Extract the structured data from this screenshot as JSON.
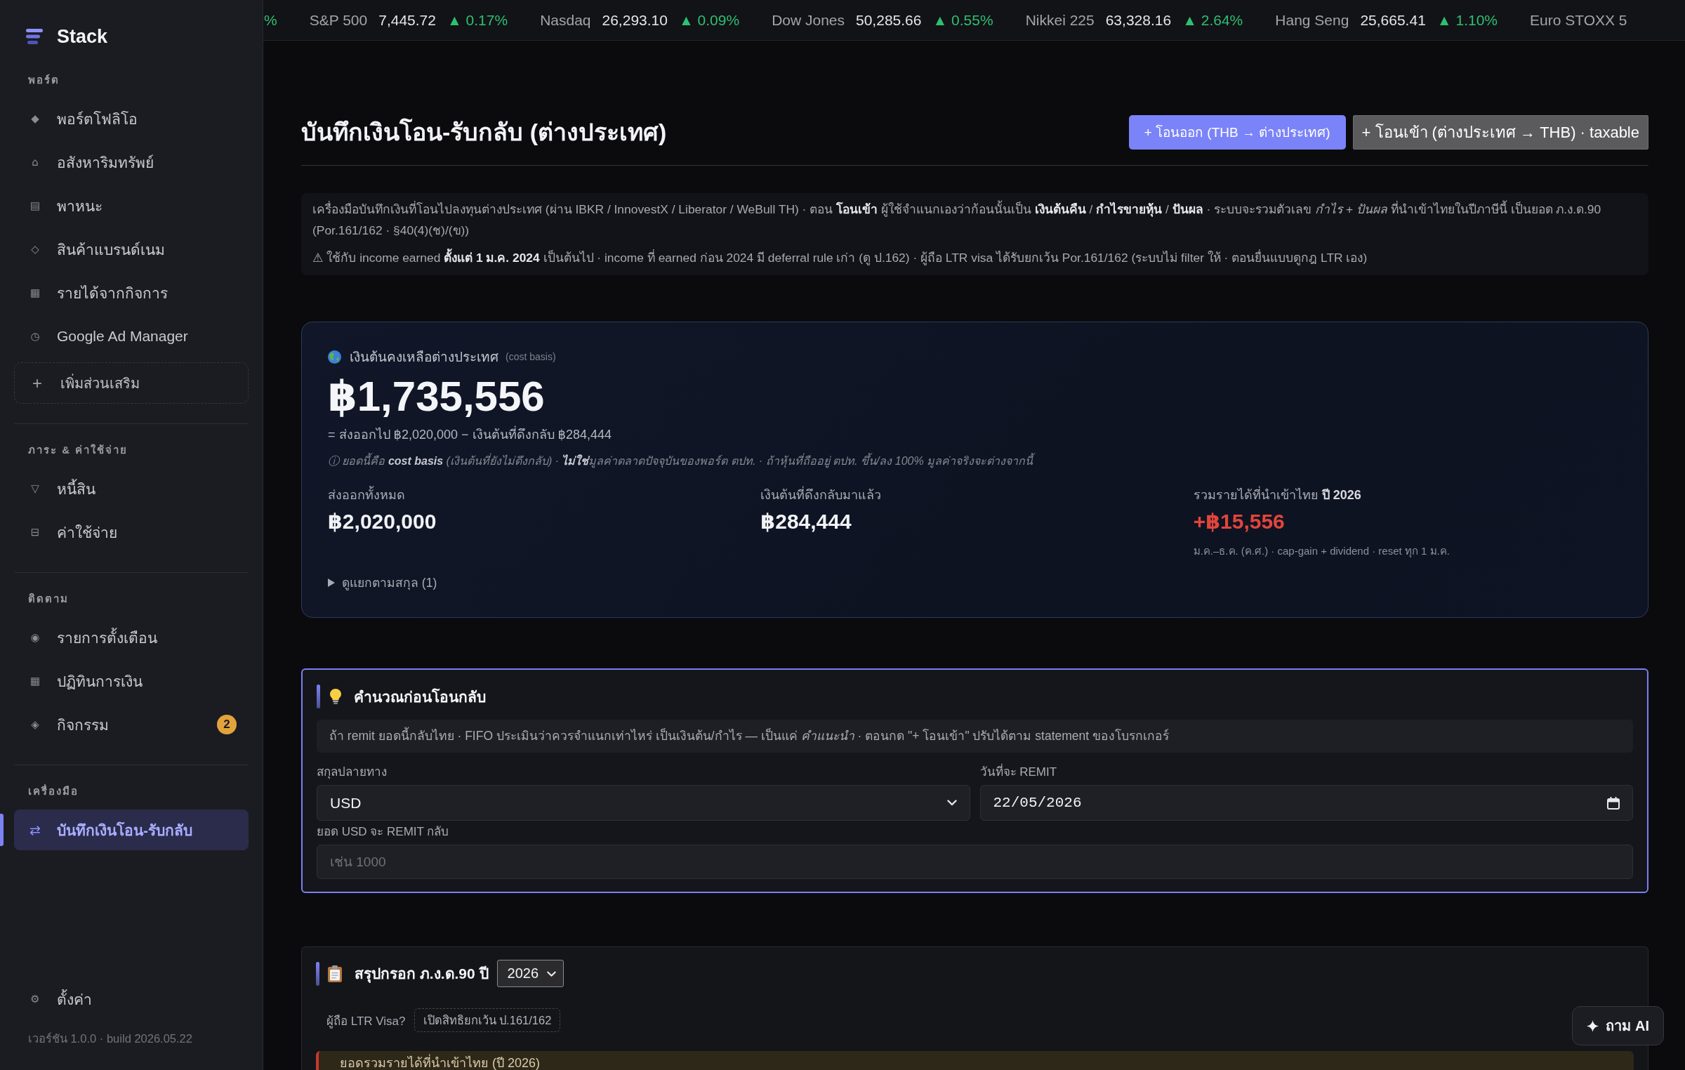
{
  "sidebar": {
    "brand": "Stack",
    "sections": [
      {
        "title": "พอร์ต",
        "items": [
          {
            "icon": "◆",
            "label": "พอร์ตโฟลิโอ",
            "selected": false
          },
          {
            "icon": "⌂",
            "label": "อสังหาริมทรัพย์",
            "selected": false
          },
          {
            "icon": "▤",
            "label": "พาหนะ",
            "selected": false
          },
          {
            "icon": "◇",
            "label": "สินค้าแบรนด์เนม",
            "selected": false
          },
          {
            "icon": "▦",
            "label": "รายได้จากกิจการ",
            "selected": false
          },
          {
            "icon": "◷",
            "label": "Google Ad Manager",
            "selected": false
          }
        ],
        "add_button": {
          "icon": "+",
          "label": "เพิ่มส่วนเสริม"
        }
      },
      {
        "title": "ภาระ & ค่าใช้จ่าย",
        "items": [
          {
            "icon": "▽",
            "label": "หนี้สิน",
            "selected": false
          },
          {
            "icon": "⊟",
            "label": "ค่าใช้จ่าย",
            "selected": false
          }
        ]
      },
      {
        "title": "ติดตาม",
        "items": [
          {
            "icon": "◉",
            "label": "รายการตั้งเตือน",
            "selected": false
          },
          {
            "icon": "▦",
            "label": "ปฏิทินการเงิน",
            "selected": false
          },
          {
            "icon": "◈",
            "label": "กิจกรรม",
            "selected": false,
            "badge": "2"
          }
        ]
      },
      {
        "title": "เครื่องมือ",
        "items": [
          {
            "icon": "⇄",
            "label": "บันทึกเงินโอน-รับกลับ",
            "selected": true
          }
        ]
      }
    ],
    "settings": {
      "icon": "⚙",
      "label": "ตั้งค่า",
      "selected": false
    },
    "version": "เวอร์ชัน 1.0.0 · build 2026.05.22"
  },
  "ticker": [
    {
      "change": "%",
      "rising": true
    },
    {
      "name": "S&P 500",
      "value": "7,445.72",
      "change": "▲ 0.17%",
      "rising": true
    },
    {
      "name": "Nasdaq",
      "value": "26,293.10",
      "change": "▲ 0.09%",
      "rising": true
    },
    {
      "name": "Dow Jones",
      "value": "50,285.66",
      "change": "▲ 0.55%",
      "rising": true
    },
    {
      "name": "Nikkei 225",
      "value": "63,328.16",
      "change": "▲ 2.64%",
      "rising": true
    },
    {
      "name": "Hang Seng",
      "value": "25,665.41",
      "change": "▲ 1.10%",
      "rising": true
    },
    {
      "name": "Euro STOXX 5"
    }
  ],
  "header": {
    "title": "บันทึกเงินโอน-รับกลับ (ต่างประเทศ)",
    "actions": [
      {
        "kind": "primary",
        "label": "+ โอนออก (THB → ต่างประเทศ)"
      },
      {
        "kind": "secondary",
        "label": "+ โอนเข้า (ต่างประเทศ → THB) · taxable"
      }
    ]
  },
  "info": {
    "paragraphs": [
      "เครื่องมือบันทึกเงินที่โอนไปลงทุนต่างประเทศ (ผ่าน IBKR / InnovestX / Liberator / WeBull TH) · ตอน **โอนเข้า** ผู้ใช้จำแนกเองว่าก้อนนั้นเป็น **เงินต้นคืน** / **กำไรขายหุ้น** / **ปันผล** · ระบบจะรวมตัวเลข *กำไร + ปันผล* ที่นำเข้าไทยในปีภาษีนี้ เป็นยอด ภ.ง.ด.90 (Por.161/162 · §40(4)(ช)/(ข))",
      "⚠ ใช้กับ income earned **ตั้งแต่ 1 ม.ค. 2024** เป็นต้นไป · income ที่ earned ก่อน 2024 มี deferral rule เก่า (ดู ป.162) · ผู้ถือ LTR visa ได้รับยกเว้น Por.161/162 (ระบบไม่ filter ให้ · ตอนยื่นแบบดูกฎ LTR เอง)"
    ]
  },
  "balance": {
    "title": "เงินต้นคงเหลือต่างประเทศ",
    "title_note": "(cost basis)",
    "amount": "฿1,735,556",
    "formula": "= ส่งออกไป ฿2,020,000 − เงินต้นที่ดึงกลับ ฿284,444",
    "note": "ⓘ ยอดนี้คือ **cost basis** (เงินต้นที่ยังไม่ดึงกลับ) · **ไม่ใช่**มูลค่าตลาดปัจจุบันของพอร์ต ตปท. · ถ้าหุ้นที่ถืออยู่ ตปท. ขึ้น/ลง 100% มูลค่าจริงจะต่างจากนี้",
    "stats": [
      {
        "kind": "plain",
        "label": "ส่งออกทั้งหมด",
        "value": "฿2,020,000"
      },
      {
        "kind": "plain",
        "label": "เงินต้นที่ดึงกลับมาแล้ว",
        "value": "฿284,444"
      },
      {
        "kind": "alert",
        "label": "รวมรายได้ที่นำเข้าไทย **ปี 2026**",
        "value": "+฿15,556",
        "note": "ม.ค.–ธ.ค. (ค.ศ.) · cap-gain + dividend · reset ทุก 1 ม.ค."
      }
    ],
    "breakdown": {
      "label": "ดูแยกตามสกุล (1)",
      "expanded": false
    }
  },
  "calculator": {
    "title": "คำนวณก่อนโอนกลับ",
    "hint": "ถ้า remit ยอดนี้กลับไทย · FIFO ประเมินว่าควรจำแนกเท่าไหร่ เป็นเงินต้น/กำไร — เป็นแค่ *คำแนะนำ* · ตอนกด \"+ โอนเข้า\" ปรับได้ตาม statement ของโบรกเกอร์",
    "fields": [
      {
        "kind": "select",
        "label": "สกุลปลายทาง",
        "value": "USD"
      },
      {
        "kind": "date",
        "label": "วันที่จะ REMIT",
        "value": "22/05/2026"
      },
      {
        "kind": "number",
        "label": "ยอด USD จะ REMIT กลับ",
        "placeholder": "เช่น 1000"
      }
    ]
  },
  "summary": {
    "title": "สรุปกรอก ภ.ง.ด.90 ปี",
    "year": "2026",
    "ltr": {
      "label": "ผู้ถือ LTR Visa?",
      "button": "เปิดสิทธิยกเว้น ป.161/162"
    },
    "warning": "ยอดรวมรายได้ที่นำเข้าไทย (ปี 2026)"
  },
  "assistant_button": {
    "label": "ถาม AI"
  }
}
